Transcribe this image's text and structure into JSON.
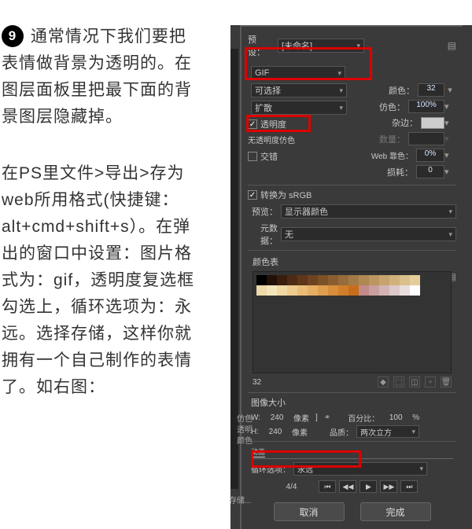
{
  "step_number": "9",
  "paragraph1": "通常情况下我们要把表情做背景为透明的。在图层面板里把最下面的背景图层隐藏掉。",
  "paragraph2": "在PS里文件>导出>存为web所用格式(快捷键：alt+cmd+shift+s）。在弹出的窗口中设置：图片格式为：gif，透明度复选框勾选上，循环选项为：永远。选择存储，这样你就拥有一个自己制作的表情了。如右图：",
  "preset": {
    "label": "预设：",
    "value": "[未命名]"
  },
  "format": {
    "value": "GIF"
  },
  "reduction": {
    "label": "可选择"
  },
  "dither": {
    "label": "扩散"
  },
  "transparency": {
    "label": "透明度",
    "checked": true
  },
  "matte_row_label": "无透明度仿色",
  "interlaced": {
    "label": "交错",
    "checked": false
  },
  "colors": {
    "label": "颜色：",
    "value": "32"
  },
  "dither_amt": {
    "label": "仿色：",
    "value": "100%"
  },
  "matte": {
    "label": "杂边："
  },
  "amount": {
    "label": "数量："
  },
  "web_snap": {
    "label": "Web 靠色：",
    "value": "0%"
  },
  "lossy": {
    "label": "损耗：",
    "value": "0"
  },
  "srgb": {
    "label": "转换为 sRGB",
    "checked": true
  },
  "preview": {
    "label": "预览：",
    "value": "显示器颜色"
  },
  "metadata": {
    "label": "元数据：",
    "value": "无"
  },
  "color_table": {
    "title": "颜色表",
    "count": "32"
  },
  "image_size": {
    "title": "图像大小",
    "w_label": "W:",
    "w_value": "240",
    "w_unit": "像素",
    "h_label": "H:",
    "h_value": "240",
    "h_unit": "像素",
    "percent_label": "百分比：",
    "percent_value": "100",
    "percent_unit": "%",
    "quality_label": "品质：",
    "quality_value": "两次立方"
  },
  "animation": {
    "tab": "动画",
    "loop_label": "循环选项：",
    "loop_value": "永远",
    "frame_pos": "4/4"
  },
  "buttons": {
    "cancel": "取消",
    "done": "完成"
  },
  "side_labels": {
    "a": "仿色",
    "b": "透明",
    "c": "颜色"
  },
  "storage_hint": "存储..."
}
